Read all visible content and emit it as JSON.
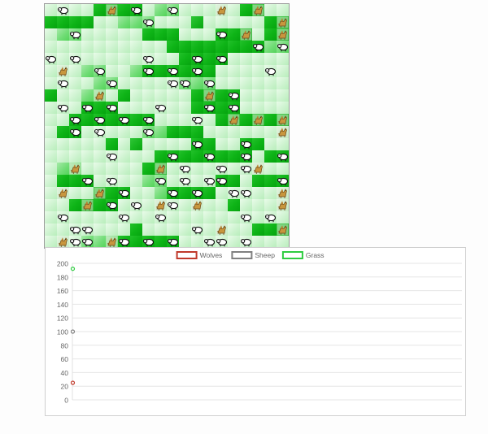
{
  "simulation": {
    "colors": {
      "light_grass": "#d2f5d3",
      "medium_grass": "#77de7c",
      "dark_grass": "#0db416",
      "wolf": "#c8963e",
      "sheep": "#ffffff",
      "grid_border": "#9a9a9a"
    },
    "grid_rows": [
      "0S002W2S01S000W02W00",
      "22220011S0003000002W",
      "01S00000222000S2W02W",
      "00000000002222222S1S",
      "S0S00000S002S2S00000",
      "0W01S001S2S2S20000S0",
      "0S001S0000SS1S000000",
      "2001W02000002W2S0000",
      "0S0S2S000S002S2S0000",
      "00S2S2S2S000S02W2W2W",
      "02S0S000S1222000000W",
      "000002030000S200S200",
      "00000S0002S22S22S02S",
      "01W000002W0S00S0SW00",
      "022S0S001S0S0SS2022S",
      "0W00W2S001S2S20SS00W",
      "002W2S0S0WS0W002000W",
      "0S0000S00S000000S0S0",
      "00SS00020000S0W0022W",
      "0WSS1WS2S2S00SS0S000"
    ],
    "legend_grid": {
      "0": "light_grass",
      "1": "medium_grass",
      "2": "dark_grass",
      "3": "dark_grass_alt",
      "S": "sheep",
      "W": "wolf"
    }
  },
  "chart_data": {
    "type": "line",
    "title": "",
    "xlabel": "",
    "ylabel": "",
    "ylim": [
      0,
      200
    ],
    "yticks": [
      "200",
      "180",
      "160",
      "140",
      "120",
      "100",
      "80",
      "60",
      "40",
      "20",
      "0"
    ],
    "grid": true,
    "legend_position": "top-center",
    "series": [
      {
        "name": "Wolves",
        "color": "#c0392b",
        "values": [
          25
        ]
      },
      {
        "name": "Sheep",
        "color": "#808080",
        "values": [
          100
        ]
      },
      {
        "name": "Grass",
        "color": "#2ecc40",
        "values": [
          192
        ]
      }
    ]
  }
}
